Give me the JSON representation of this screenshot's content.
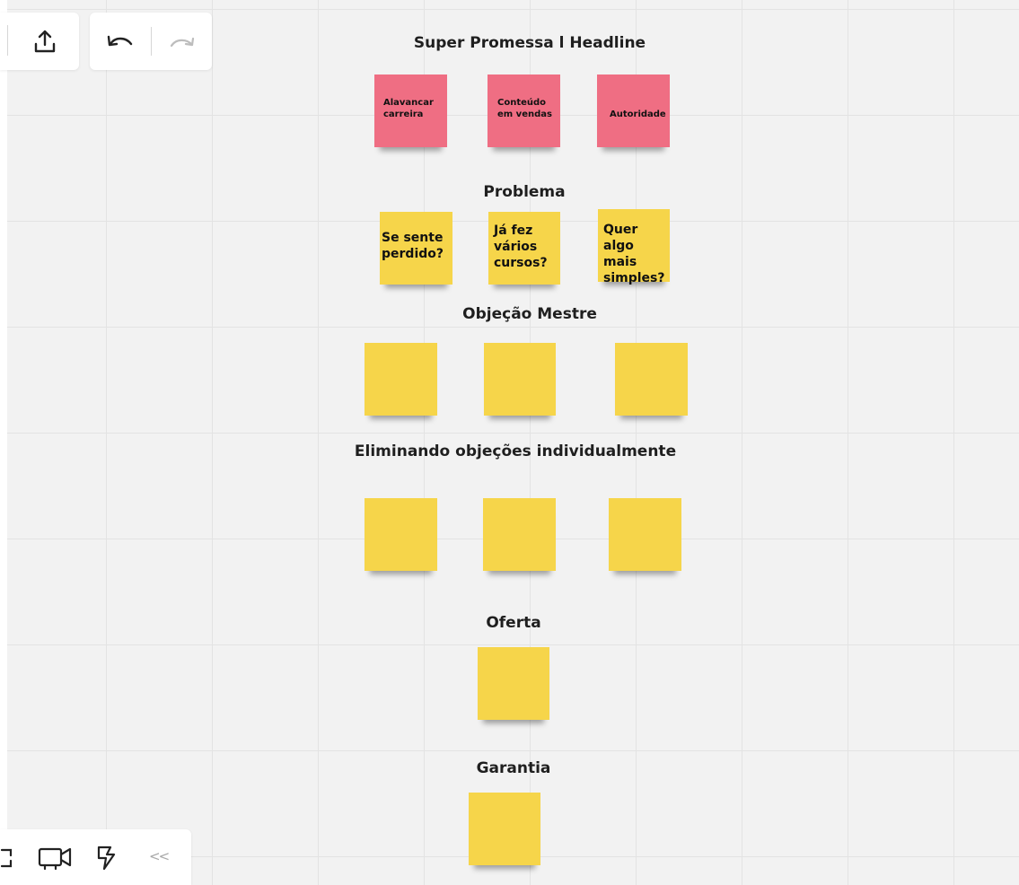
{
  "toolbar_top": {
    "share_icon": "upload-icon",
    "undo_icon": "undo-icon",
    "redo_icon": "redo-icon"
  },
  "toolbar_bottom": {
    "icons": [
      "fit-screen-icon",
      "video-icon",
      "lightning-icon",
      "collapse-icon"
    ],
    "collapse_glyph": "<<"
  },
  "sections": {
    "headline": "Super Promessa l Headline",
    "problem": "Problema",
    "master_objection": "Objeção Mestre",
    "objections": "Eliminando objeções individualmente",
    "offer": "Oferta",
    "guarantee": "Garantia"
  },
  "notes": {
    "headline": [
      "Alavancar\ncarreira",
      "Conteúdo\nem vendas",
      "Autoridade"
    ],
    "problem": [
      "Se sente\nperdido?",
      "Já fez\nvários\ncursos?",
      "Quer\nalgo mais\nsimples?"
    ],
    "master_objection": [
      "",
      "",
      ""
    ],
    "objections": [
      "",
      "",
      ""
    ],
    "offer": [
      ""
    ],
    "guarantee": [
      ""
    ]
  },
  "colors": {
    "pink_note": "#ef6e83",
    "yellow_note": "#f6d54a",
    "board_background": "#f2f2f2",
    "grid_line": "#e3e3e3"
  }
}
